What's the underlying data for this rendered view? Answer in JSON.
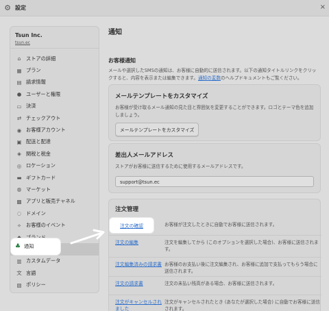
{
  "topbar": {
    "title": "設定",
    "close": "×"
  },
  "store": {
    "name": "Tsun Inc.",
    "domain": "tsun.ec"
  },
  "sidebar": {
    "items": [
      {
        "label": "ストアの詳細",
        "icon": "store-icon",
        "glyph": "⌂"
      },
      {
        "label": "プラン",
        "icon": "plan-icon",
        "glyph": "▦"
      },
      {
        "label": "請求情報",
        "icon": "billing-icon",
        "glyph": "▤"
      },
      {
        "label": "ユーザーと権限",
        "icon": "users-icon",
        "glyph": "●"
      },
      {
        "label": "決済",
        "icon": "payment-icon",
        "glyph": "▭"
      },
      {
        "label": "チェックアウト",
        "icon": "checkout-icon",
        "glyph": "⇄"
      },
      {
        "label": "お客様アカウント",
        "icon": "customer-account-icon",
        "glyph": "◉"
      },
      {
        "label": "配送と配達",
        "icon": "shipping-icon",
        "glyph": "▣"
      },
      {
        "label": "関税と税金",
        "icon": "taxes-icon",
        "glyph": "◈"
      },
      {
        "label": "ロケーション",
        "icon": "location-icon",
        "glyph": "◎"
      },
      {
        "label": "ギフトカード",
        "icon": "giftcard-icon",
        "glyph": "▬"
      },
      {
        "label": "マーケット",
        "icon": "markets-icon",
        "glyph": "◍"
      },
      {
        "label": "アプリと販売チャネル",
        "icon": "apps-icon",
        "glyph": "▩"
      },
      {
        "label": "ドメイン",
        "icon": "domain-icon",
        "glyph": "◌"
      },
      {
        "label": "お客様のイベント",
        "icon": "events-icon",
        "glyph": "✧"
      },
      {
        "label": "ブランド",
        "icon": "brand-icon",
        "glyph": "◆"
      },
      {
        "label": "通知",
        "icon": "notification-icon",
        "glyph": "♣"
      },
      {
        "label": "カスタムデータ",
        "icon": "custom-data-icon",
        "glyph": "▥"
      },
      {
        "label": "言語",
        "icon": "language-icon",
        "glyph": "文"
      },
      {
        "label": "ポリシー",
        "icon": "policy-icon",
        "glyph": "▧"
      }
    ],
    "active_index": 16
  },
  "highlight_nav": {
    "label": "通知",
    "glyph": "♣"
  },
  "main": {
    "title": "通知",
    "customer_notice_heading": "お客様通知",
    "customer_notice_desc_1": "メールや選択したSMSの通知は、お客様に自動的に送信されます。以下の通知タイトルリンクをクリックすると、内容を表示または編集できます。",
    "customer_notice_link": "通知の変数",
    "customer_notice_desc_2": "のヘルプドキュメントもご覧ください。"
  },
  "template_card": {
    "title": "メールテンプレートをカスタマイズ",
    "desc": "お客様が受け取るメール通知の見た目と雰囲気を変更することができます。ロゴとテーマ色を追加しましょう。",
    "button": "メールテンプレートをカスタマイズ"
  },
  "sender_card": {
    "title": "差出人メールアドレス",
    "desc": "ストアがお客様に送信するために使用するメールアドレスです。",
    "email": "support@tsun.ec"
  },
  "order_card": {
    "title": "注文管理",
    "rows": [
      {
        "link": "注文の確認",
        "desc": "お客様が注文したときに自動でお客様に送信されます。"
      },
      {
        "link": "注文の編集",
        "desc": "注文を編集してから (このオプションを選択した場合)、お客様に送信されます。"
      },
      {
        "link": "注文編集済みの請求書",
        "desc": "お客様のお支払い後に注文編集され、お客様に追加で支払ってもらう場合に送信されます。"
      },
      {
        "link": "注文の請求書",
        "desc": "注文の未払い残高がある場合、お客様に送信されます。"
      },
      {
        "link": "注文がキャンセルされました",
        "desc": "注文がキャンセルされたとき (あなたが選択した場合) に自動でお客様に送信されます。"
      }
    ]
  },
  "highlight_link": "注文の確認",
  "colors": {
    "accent": "#2c6ecb",
    "active_icon": "#1f7a3a",
    "overlay": "#dcdcdc"
  }
}
